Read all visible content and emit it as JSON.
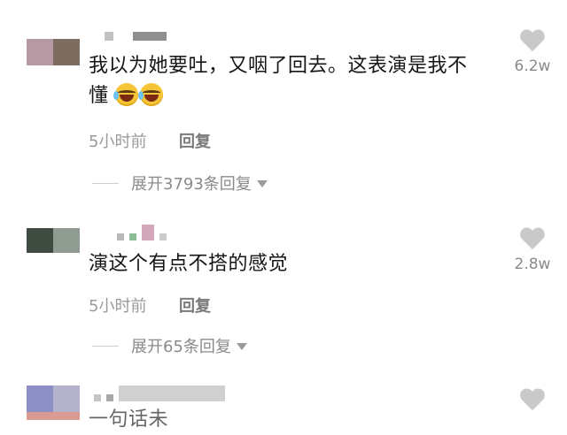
{
  "comments": [
    {
      "text_line1": "我以为她要吐，又咽了回去。这表演是我不",
      "text_line2": "懂",
      "emojis": [
        "laugh-cry-emoji",
        "laugh-cry-emoji"
      ],
      "time": "5小时前",
      "reply_label": "回复",
      "expand_label": "展开3793条回复",
      "likes": "6.2w",
      "avatar_colors": [
        "#b69aa3",
        "#7d6d60"
      ],
      "name_blur_colors": [
        "#c2c2c2",
        "#8e8e8e"
      ]
    },
    {
      "text_line1": "演这个有点不搭的感觉",
      "time": "5小时前",
      "reply_label": "回复",
      "expand_label": "展开65条回复",
      "likes": "2.8w",
      "avatar_colors": [
        "#3f4a40",
        "#8f9a90"
      ],
      "name_blur_colors": [
        "#b8b8b8",
        "#8ebc96",
        "#d4a8bb",
        "#cccccc"
      ]
    },
    {
      "avatar_colors": [
        "#8d8fc4",
        "#b5b3cc"
      ],
      "name_blur_colors": [
        "#c5c5c5",
        "#a8a8a8",
        "#d0d0d0"
      ],
      "text_partial": "一句话未"
    }
  ],
  "icons": {
    "heart": "heart-icon",
    "caret": "caret-down-icon"
  },
  "colors": {
    "heart": "#c9c9c9",
    "muted_text": "#9a9a9a",
    "text": "#161616"
  }
}
